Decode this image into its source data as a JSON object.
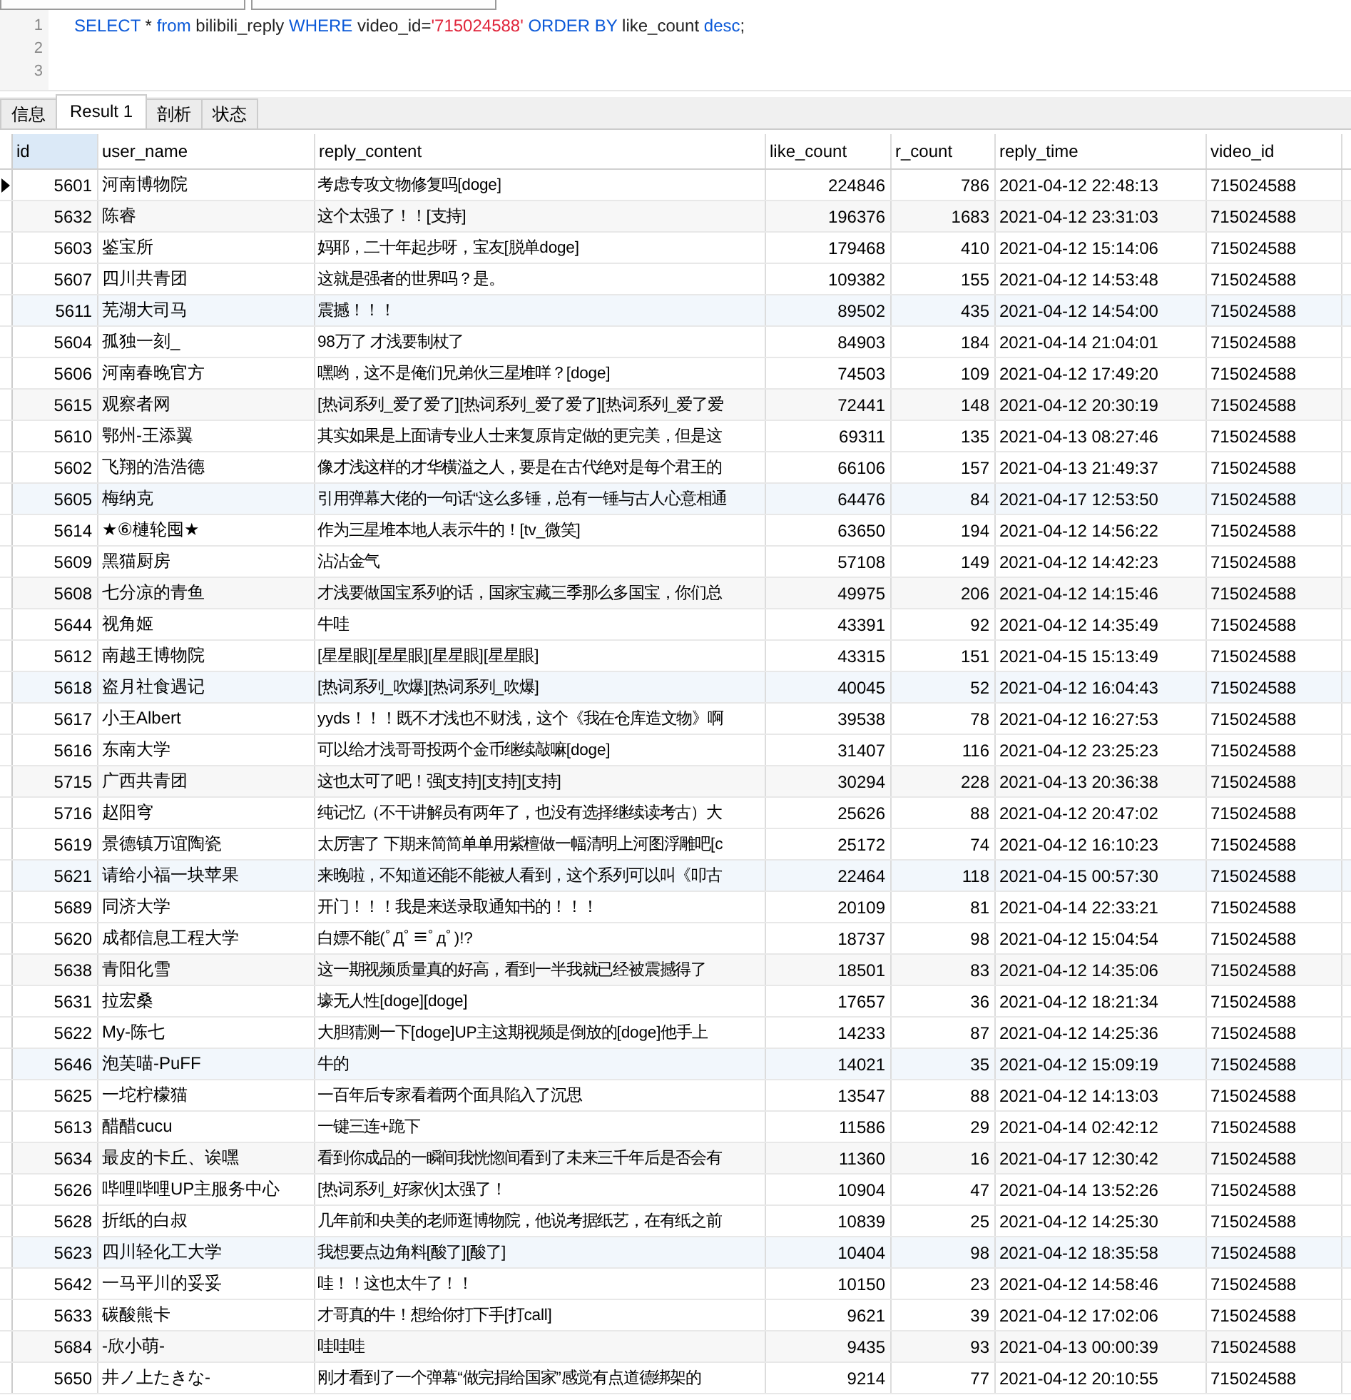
{
  "editor": {
    "lines": [
      {
        "number": "1",
        "tokens": [
          {
            "kind": "keyword",
            "text": "SELECT"
          },
          {
            "kind": "plain",
            "text": " * "
          },
          {
            "kind": "keyword",
            "text": "from"
          },
          {
            "kind": "plain",
            "text": " bilibili_reply "
          },
          {
            "kind": "keyword",
            "text": "WHERE"
          },
          {
            "kind": "plain",
            "text": " video_id="
          },
          {
            "kind": "string",
            "text": "'715024588' "
          },
          {
            "kind": "keyword",
            "text": "ORDER BY"
          },
          {
            "kind": "plain",
            "text": " like_count "
          },
          {
            "kind": "keyword",
            "text": "desc"
          },
          {
            "kind": "plain",
            "text": ";"
          }
        ]
      },
      {
        "number": "2"
      },
      {
        "number": "3"
      }
    ]
  },
  "tabs": [
    {
      "label": "信息",
      "selected": false
    },
    {
      "label": "Result 1",
      "selected": true
    },
    {
      "label": "剖析",
      "selected": false
    },
    {
      "label": "状态",
      "selected": false
    }
  ],
  "table": {
    "columns": [
      {
        "label": "id",
        "selected": true
      },
      {
        "label": "user_name",
        "selected": false
      },
      {
        "label": "reply_content",
        "selected": false
      },
      {
        "label": "like_count",
        "selected": false
      },
      {
        "label": "r_count",
        "selected": false
      },
      {
        "label": "reply_time",
        "selected": false
      },
      {
        "label": "video_id",
        "selected": false
      }
    ],
    "rows": [
      {
        "selected": true,
        "cells": [
          "5601",
          "河南博物院",
          "考虑专攻文物修复吗[doge]",
          "224846",
          "786",
          "2021-04-12 22:48:13",
          "715024588"
        ]
      },
      {
        "selected": false,
        "cells": [
          "5632",
          "陈睿",
          "这个太强了！！[支持]",
          "196376",
          "1683",
          "2021-04-12 23:31:03",
          "715024588"
        ]
      },
      {
        "selected": false,
        "cells": [
          "5603",
          "鉴宝所",
          "妈耶，二十年起步呀，宝友[脱单doge]",
          "179468",
          "410",
          "2021-04-12 15:14:06",
          "715024588"
        ]
      },
      {
        "selected": false,
        "cells": [
          "5607",
          "四川共青团",
          "这就是强者的世界吗？是。",
          "109382",
          "155",
          "2021-04-12 14:53:48",
          "715024588"
        ]
      },
      {
        "selected": false,
        "cells": [
          "5611",
          "芜湖大司马",
          "震撼！！！",
          "89502",
          "435",
          "2021-04-12 14:54:00",
          "715024588"
        ]
      },
      {
        "selected": false,
        "cells": [
          "5604",
          "孤独一刻_",
          "98万了  才浅要制杖了",
          "84903",
          "184",
          "2021-04-14 21:04:01",
          "715024588"
        ]
      },
      {
        "selected": false,
        "cells": [
          "5606",
          "河南春晚官方",
          "嘿哟，这不是俺们兄弟伙三星堆咩？[doge]",
          "74503",
          "109",
          "2021-04-12 17:49:20",
          "715024588"
        ]
      },
      {
        "selected": false,
        "cells": [
          "5615",
          "观察者网",
          "[热词系列_爱了爱了][热词系列_爱了爱了][热词系列_爱了爱",
          "72441",
          "148",
          "2021-04-12 20:30:19",
          "715024588"
        ]
      },
      {
        "selected": false,
        "cells": [
          "5610",
          "鄂州-王添翼",
          "其实如果是上面请专业人士来复原肯定做的更完美，但是这",
          "69311",
          "135",
          "2021-04-13 08:27:46",
          "715024588"
        ]
      },
      {
        "selected": false,
        "cells": [
          "5602",
          "飞翔的浩浩德",
          "像才浅这样的才华横溢之人，要是在古代绝对是每个君王的",
          "66106",
          "157",
          "2021-04-13 21:49:37",
          "715024588"
        ]
      },
      {
        "selected": false,
        "cells": [
          "5605",
          "梅纳克",
          "引用弹幕大佬的一句话“这么多锤，总有一锤与古人心意相通",
          "64476",
          "84",
          "2021-04-17 12:53:50",
          "715024588"
        ]
      },
      {
        "selected": false,
        "cells": [
          "5614",
          "★⑥槤轮囤★",
          "作为三星堆本地人表示牛的！[tv_微笑]",
          "63650",
          "194",
          "2021-04-12 14:56:22",
          "715024588"
        ]
      },
      {
        "selected": false,
        "cells": [
          "5609",
          "黑猫厨房",
          "沾沾金气",
          "57108",
          "149",
          "2021-04-12 14:42:23",
          "715024588"
        ]
      },
      {
        "selected": false,
        "cells": [
          "5608",
          "七分凉的青鱼",
          "才浅要做国宝系列的话，国家宝藏三季那么多国宝，你们总",
          "49975",
          "206",
          "2021-04-12 14:15:46",
          "715024588"
        ]
      },
      {
        "selected": false,
        "cells": [
          "5644",
          "视角姬",
          "牛哇",
          "43391",
          "92",
          "2021-04-12 14:35:49",
          "715024588"
        ]
      },
      {
        "selected": false,
        "cells": [
          "5612",
          "南越王博物院",
          "[星星眼][星星眼][星星眼][星星眼]",
          "43315",
          "151",
          "2021-04-15 15:13:49",
          "715024588"
        ]
      },
      {
        "selected": false,
        "cells": [
          "5618",
          "盗月社食遇记",
          "[热词系列_吹爆][热词系列_吹爆]",
          "40045",
          "52",
          "2021-04-12 16:04:43",
          "715024588"
        ]
      },
      {
        "selected": false,
        "cells": [
          "5617",
          "小王Albert",
          "yyds！！！既不才浅也不财浅，这个《我在仓库造文物》啊",
          "39538",
          "78",
          "2021-04-12 16:27:53",
          "715024588"
        ]
      },
      {
        "selected": false,
        "cells": [
          "5616",
          "东南大学",
          "可以给才浅哥哥投两个金币继续敲嘛[doge]",
          "31407",
          "116",
          "2021-04-12 23:25:23",
          "715024588"
        ]
      },
      {
        "selected": false,
        "cells": [
          "5715",
          "广西共青团",
          "这也太可了吧！强[支持][支持][支持]",
          "30294",
          "228",
          "2021-04-13 20:36:38",
          "715024588"
        ]
      },
      {
        "selected": false,
        "cells": [
          "5716",
          "赵阳穹",
          "纯记忆（不干讲解员有两年了，也没有选择继续读考古）大",
          "25626",
          "88",
          "2021-04-12 20:47:02",
          "715024588"
        ]
      },
      {
        "selected": false,
        "cells": [
          "5619",
          "景德镇万谊陶瓷",
          "太厉害了 下期来简简单单用紫檀做一幅清明上河图浮雕吧[c",
          "25172",
          "74",
          "2021-04-12 16:10:23",
          "715024588"
        ]
      },
      {
        "selected": false,
        "cells": [
          "5621",
          "请给小福一块苹果",
          "来晚啦，不知道还能不能被人看到，这个系列可以叫《叩古",
          "22464",
          "118",
          "2021-04-15 00:57:30",
          "715024588"
        ]
      },
      {
        "selected": false,
        "cells": [
          "5689",
          "同济大学",
          "开门！！！我是来送录取通知书的！！！",
          "20109",
          "81",
          "2021-04-14 22:33:21",
          "715024588"
        ]
      },
      {
        "selected": false,
        "cells": [
          "5620",
          "成都信息工程大学",
          "白嫖不能(ﾟДﾟ≡ﾟдﾟ)!?",
          "18737",
          "98",
          "2021-04-12 15:04:54",
          "715024588"
        ]
      },
      {
        "selected": false,
        "cells": [
          "5638",
          "青阳化雪",
          "这一期视频质量真的好高，看到一半我就已经被震撼得了",
          "18501",
          "83",
          "2021-04-12 14:35:06",
          "715024588"
        ]
      },
      {
        "selected": false,
        "cells": [
          "5631",
          "拉宏桑",
          "壕无人性[doge][doge]",
          "17657",
          "36",
          "2021-04-12 18:21:34",
          "715024588"
        ]
      },
      {
        "selected": false,
        "cells": [
          "5622",
          "My-陈七",
          "大胆猜测一下[doge]UP主这期视频是倒放的[doge]他手上",
          "14233",
          "87",
          "2021-04-12 14:25:36",
          "715024588"
        ]
      },
      {
        "selected": false,
        "cells": [
          "5646",
          "泡芙喵-PuFF",
          "牛的",
          "14021",
          "35",
          "2021-04-12 15:09:19",
          "715024588"
        ]
      },
      {
        "selected": false,
        "cells": [
          "5625",
          "一坨柠檬猫",
          "一百年后专家看着两个面具陷入了沉思",
          "13547",
          "88",
          "2021-04-12 14:13:03",
          "715024588"
        ]
      },
      {
        "selected": false,
        "cells": [
          "5613",
          "醋醋cucu",
          "一键三连+跪下",
          "11586",
          "29",
          "2021-04-14 02:42:12",
          "715024588"
        ]
      },
      {
        "selected": false,
        "cells": [
          "5634",
          "最皮的卡丘、诶嘿",
          "看到你成品的一瞬间我恍惚间看到了未来三千年后是否会有",
          "11360",
          "16",
          "2021-04-17 12:30:42",
          "715024588"
        ]
      },
      {
        "selected": false,
        "cells": [
          "5626",
          "哔哩哔哩UP主服务中心",
          "[热词系列_好家伙]太强了！",
          "10904",
          "47",
          "2021-04-14 13:52:26",
          "715024588"
        ]
      },
      {
        "selected": false,
        "cells": [
          "5628",
          "折纸的白叔",
          "几年前和央美的老师逛博物院，他说考据纸艺，在有纸之前",
          "10839",
          "25",
          "2021-04-12 14:25:30",
          "715024588"
        ]
      },
      {
        "selected": false,
        "cells": [
          "5623",
          "四川轻化工大学",
          "我想要点边角料[酸了][酸了]",
          "10404",
          "98",
          "2021-04-12 18:35:58",
          "715024588"
        ]
      },
      {
        "selected": false,
        "cells": [
          "5642",
          "一马平川的妥妥",
          "哇！！这也太牛了！！",
          "10150",
          "23",
          "2021-04-12 14:58:46",
          "715024588"
        ]
      },
      {
        "selected": false,
        "cells": [
          "5633",
          "碳酸熊卡",
          "才哥真的牛！想给你打下手[打call]",
          "9621",
          "39",
          "2021-04-12 17:02:06",
          "715024588"
        ]
      },
      {
        "selected": false,
        "cells": [
          "5684",
          "-欣小萌-",
          "哇哇哇",
          "9435",
          "93",
          "2021-04-13 00:00:39",
          "715024588"
        ]
      },
      {
        "selected": false,
        "cells": [
          "5650",
          "井ノ上たきな-",
          "刚才看到了一个弹幕“做完捐给国家”感觉有点道德绑架的",
          "9214",
          "77",
          "2021-04-12 20:10:55",
          "715024588"
        ]
      }
    ]
  }
}
